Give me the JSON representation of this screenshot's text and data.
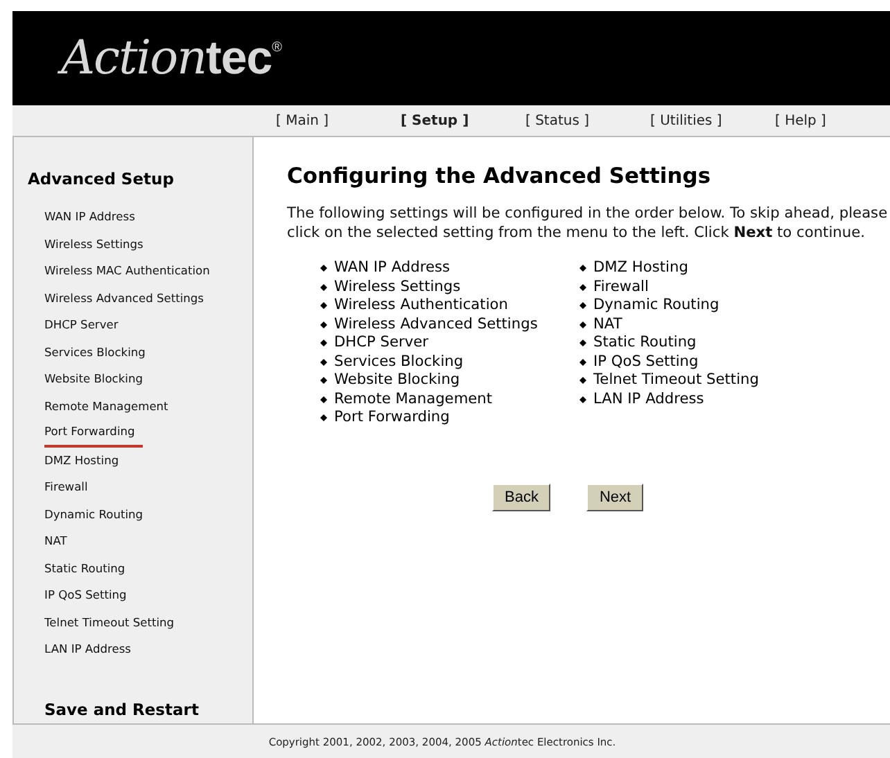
{
  "logo": {
    "script": "Action",
    "bold": "tec",
    "mark": "®"
  },
  "nav": [
    {
      "label": "[ Main ]",
      "selected": false
    },
    {
      "label": "[ Setup ]",
      "selected": true
    },
    {
      "label": "[ Status ]",
      "selected": false
    },
    {
      "label": "[ Utilities ]",
      "selected": false
    },
    {
      "label": "[ Help ]",
      "selected": false
    }
  ],
  "sidebar": {
    "title": "Advanced Setup",
    "items": [
      {
        "label": "WAN IP Address",
        "selected": false
      },
      {
        "label": "Wireless Settings",
        "selected": false
      },
      {
        "label": "Wireless MAC Authentication",
        "selected": false
      },
      {
        "label": "Wireless Advanced Settings",
        "selected": false
      },
      {
        "label": "DHCP Server",
        "selected": false
      },
      {
        "label": "Services Blocking",
        "selected": false
      },
      {
        "label": "Website Blocking",
        "selected": false
      },
      {
        "label": "Remote Management",
        "selected": false
      },
      {
        "label": "Port Forwarding",
        "selected": true
      },
      {
        "label": "DMZ Hosting",
        "selected": false
      },
      {
        "label": "Firewall",
        "selected": false
      },
      {
        "label": "Dynamic Routing",
        "selected": false
      },
      {
        "label": "NAT",
        "selected": false
      },
      {
        "label": "Static Routing",
        "selected": false
      },
      {
        "label": "IP QoS Setting",
        "selected": false
      },
      {
        "label": "Telnet Timeout Setting",
        "selected": false
      },
      {
        "label": "LAN IP Address",
        "selected": false
      }
    ],
    "save": "Save and Restart"
  },
  "main": {
    "heading": "Configuring the Advanced Settings",
    "intro": "The following settings will be configured in the order below. To skip ahead, please click on the selected setting from the menu to the left. Click **Next** to continue.",
    "list_columns": [
      [
        "WAN IP Address",
        "Wireless Settings",
        "Wireless Authentication",
        "Wireless Advanced Settings",
        "DHCP Server",
        "Services Blocking",
        "Website Blocking",
        "Remote Management",
        "Port Forwarding"
      ],
      [
        "DMZ Hosting",
        "Firewall",
        "Dynamic Routing",
        "NAT",
        "Static Routing",
        "IP QoS Setting",
        "Telnet Timeout Setting",
        "LAN IP Address"
      ]
    ],
    "buttons": [
      "Back",
      "Next"
    ]
  },
  "footer": {
    "before": "Copyright 2001, 2002, 2003, 2004, 2005 ",
    "script": "Action",
    "bold": "tec",
    "after": " Electronics Inc."
  }
}
